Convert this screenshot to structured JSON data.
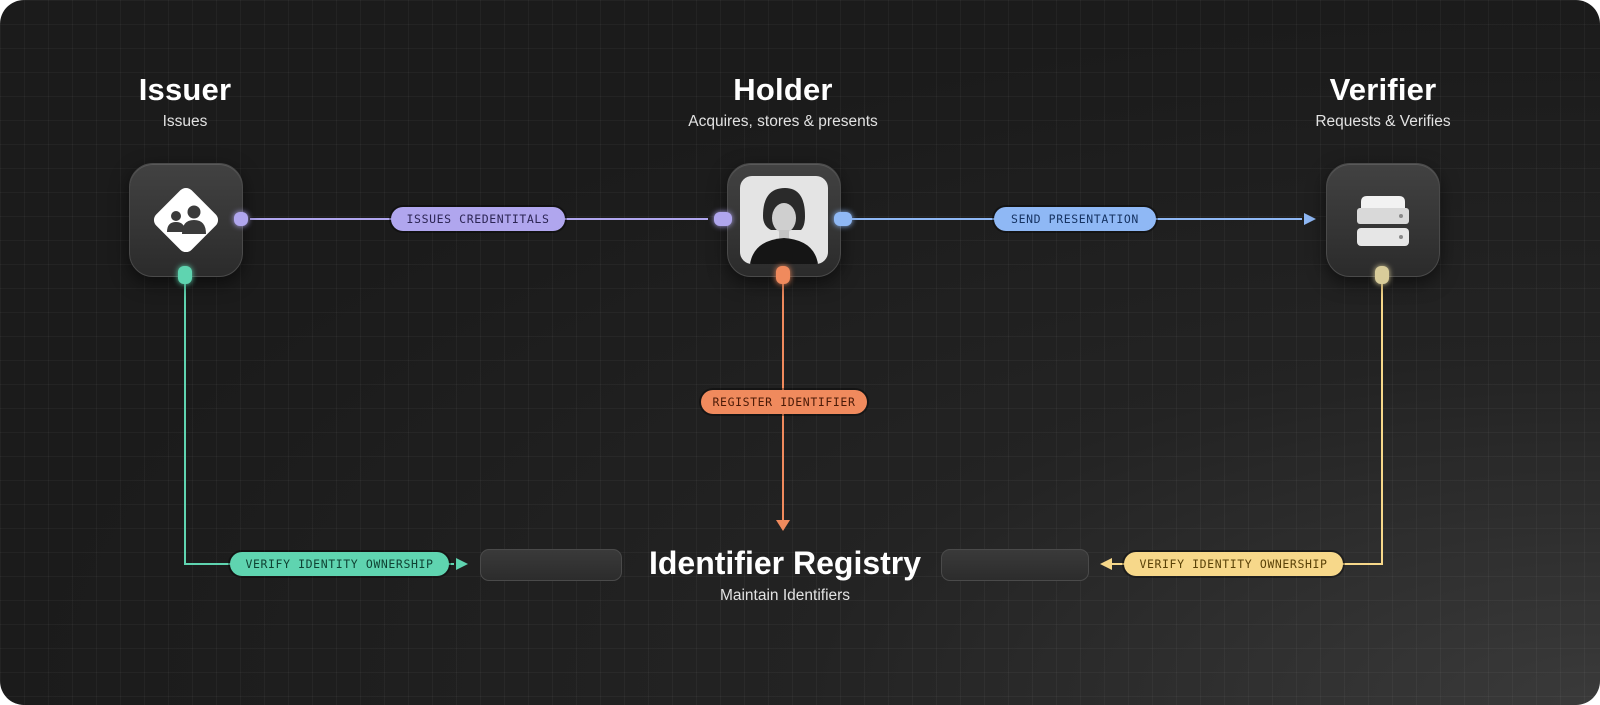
{
  "issuer": {
    "title": "Issuer",
    "subtitle": "Issues",
    "icon": "group-diamond-icon"
  },
  "holder": {
    "title": "Holder",
    "subtitle": "Acquires, stores & presents",
    "icon": "person-photo-icon"
  },
  "verifier": {
    "title": "Verifier",
    "subtitle": "Requests & Verifies",
    "icon": "server-icon"
  },
  "registry": {
    "title": "Identifier Registry",
    "subtitle": "Maintain Identifiers"
  },
  "edges": {
    "issue": {
      "label": "ISSUES CREDENTITALS",
      "color": "#b0a6ee"
    },
    "present": {
      "label": "SEND PRESENTATION",
      "color": "#8fb8f5"
    },
    "register": {
      "label": "REGISTER IDENTIFIER",
      "color": "#f08a5d"
    },
    "verify_issuer": {
      "label": "VERIFY IDENTITY OWNERSHIP",
      "color": "#5fd4b0"
    },
    "verify_verifier": {
      "label": "VERIFY IDENTITY OWNERSHIP",
      "color": "#f7d88a"
    }
  }
}
